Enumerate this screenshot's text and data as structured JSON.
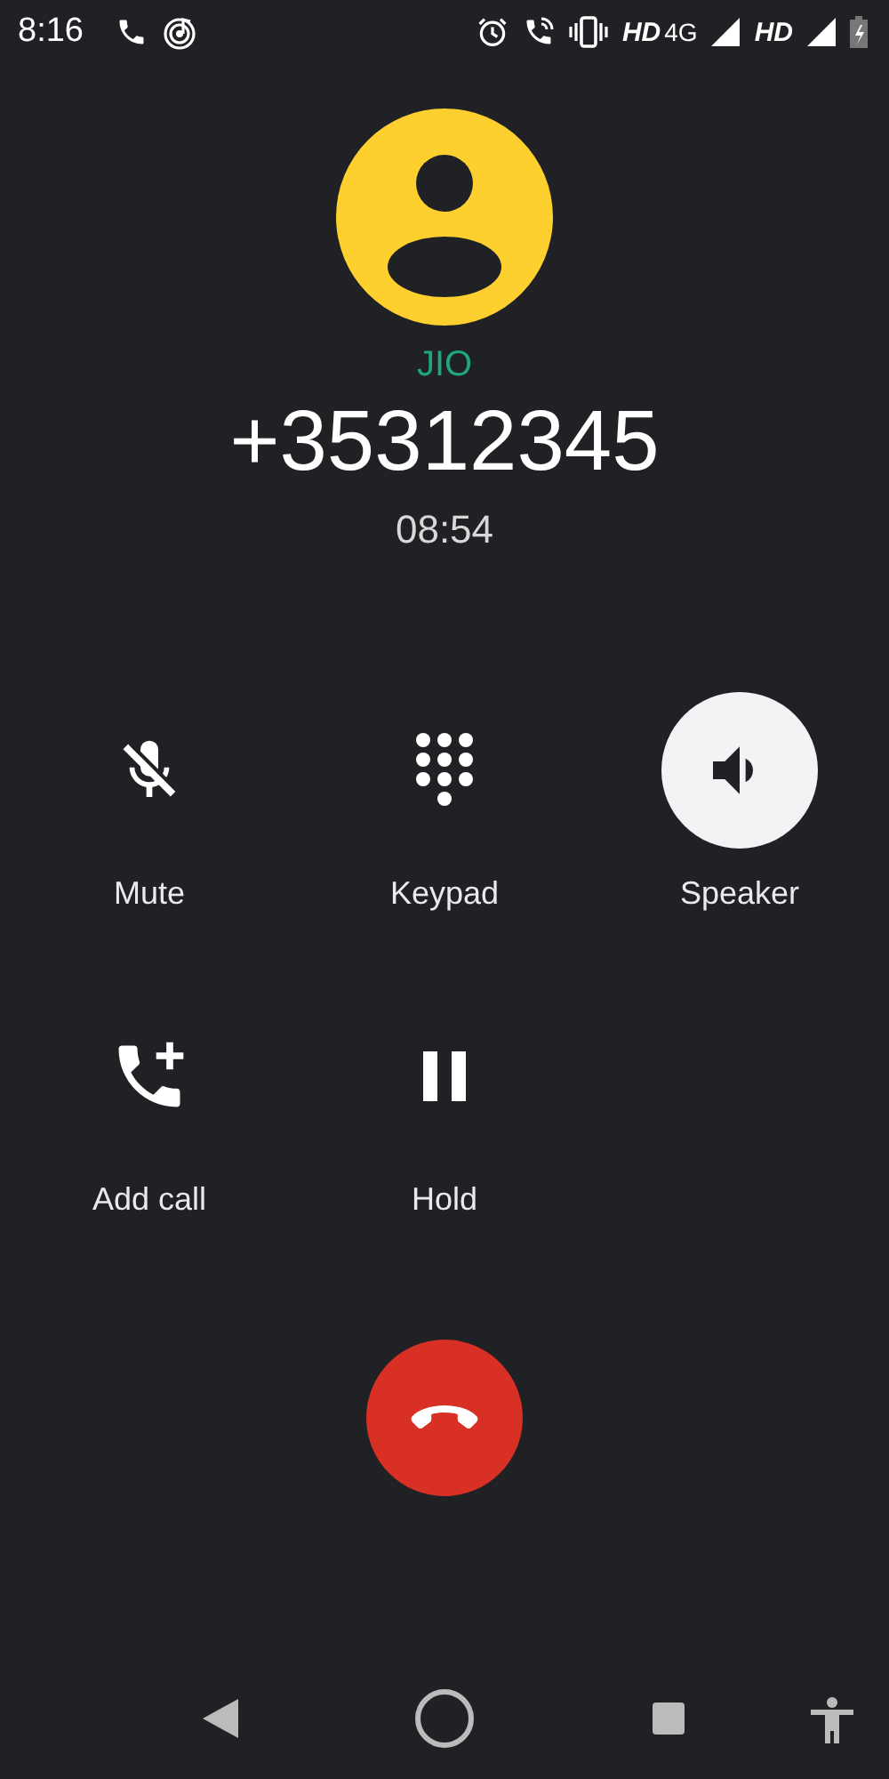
{
  "status_bar": {
    "time": "8:16",
    "network_1": "HD",
    "network_type": "4G",
    "network_2": "HD"
  },
  "caller": {
    "carrier": "JIO",
    "number": "+35312345",
    "duration": "08:54"
  },
  "controls": [
    {
      "kind": "mute",
      "label": "Mute",
      "selected": false
    },
    {
      "kind": "keypad",
      "label": "Keypad",
      "selected": false
    },
    {
      "kind": "speaker",
      "label": "Speaker",
      "selected": true
    },
    {
      "kind": "add-call",
      "label": "Add call",
      "selected": false
    },
    {
      "kind": "hold",
      "label": "Hold",
      "selected": false
    }
  ]
}
